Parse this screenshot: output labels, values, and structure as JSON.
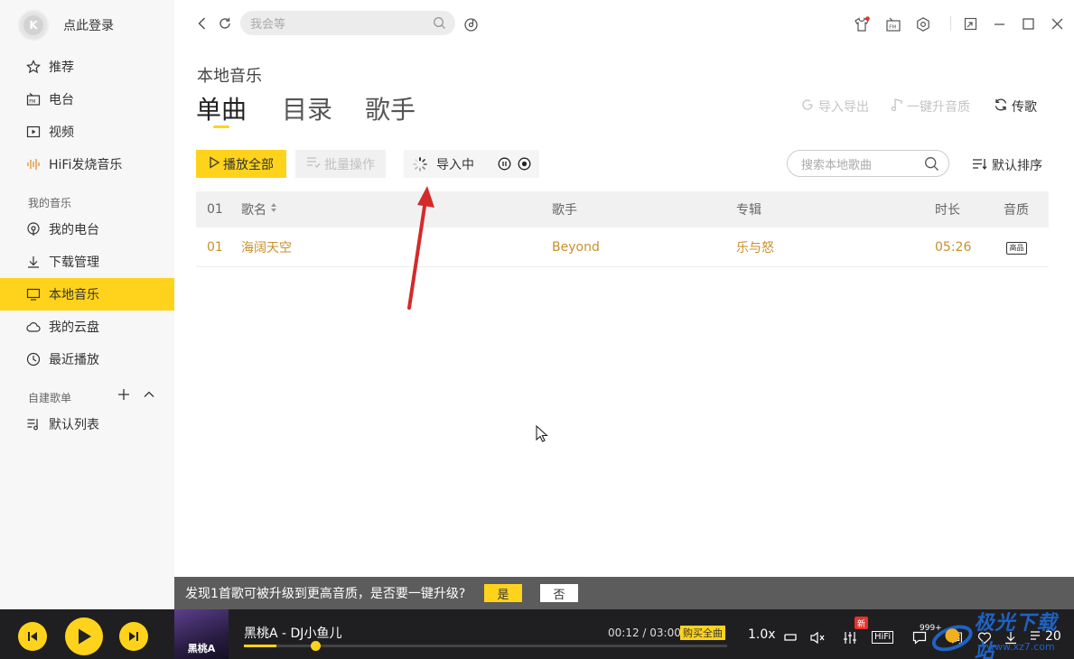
{
  "sidebar": {
    "login_text": "点此登录",
    "items": [
      {
        "label": "推荐",
        "icon": "star-icon"
      },
      {
        "label": "电台",
        "icon": "radio-icon"
      },
      {
        "label": "视频",
        "icon": "video-icon"
      },
      {
        "label": "HiFi发烧音乐",
        "icon": "waveform-icon"
      }
    ],
    "my_music_label": "我的音乐",
    "my_items": [
      {
        "label": "我的电台",
        "icon": "podcast-icon"
      },
      {
        "label": "下载管理",
        "icon": "download-icon"
      },
      {
        "label": "本地音乐",
        "icon": "monitor-icon",
        "active": true
      },
      {
        "label": "我的云盘",
        "icon": "cloud-icon"
      },
      {
        "label": "最近播放",
        "icon": "clock-icon"
      }
    ],
    "playlist_label": "自建歌单",
    "playlists": [
      {
        "label": "默认列表",
        "icon": "playlist-icon"
      }
    ]
  },
  "topbar": {
    "search_placeholder": "我会等"
  },
  "main": {
    "page_title": "本地音乐",
    "tabs": [
      {
        "label": "单曲",
        "active": true
      },
      {
        "label": "目录"
      },
      {
        "label": "歌手"
      }
    ],
    "actions": {
      "import_export": "导入导出",
      "upgrade_quality": "一键升音质",
      "upload": "传歌"
    },
    "toolbar": {
      "play_all": "播放全部",
      "batch": "批量操作",
      "importing": "导入中",
      "search_placeholder": "搜索本地歌曲",
      "sort": "默认排序"
    },
    "table": {
      "headers": {
        "num": "01",
        "title": "歌名",
        "artist": "歌手",
        "album": "专辑",
        "duration": "时长",
        "quality": "音质"
      },
      "rows": [
        {
          "num": "01",
          "title": "海阔天空",
          "artist": "Beyond",
          "album": "乐与怒",
          "duration": "05:26",
          "quality": "高品"
        }
      ]
    }
  },
  "upgrade_bar": {
    "message": "发现1首歌可被升级到更高音质，是否要一键升级?",
    "yes": "是",
    "no": "否"
  },
  "player": {
    "cover_text": "黑桃A",
    "track": "黑桃A - DJ小鱼儿",
    "time": "00:12 / 03:00",
    "buy": "购买全曲",
    "progress": 0.067,
    "speed": "1.0x",
    "hifi": "HiFi",
    "new_badge": "新",
    "comments": "999+",
    "lyric": "词",
    "playlist_count": "20"
  },
  "watermark": {
    "text": "极光下载站",
    "url": "www.xz7.com"
  },
  "colors": {
    "accent": "#ffd31b",
    "song_text": "#c8902c",
    "player_bg": "#1f1f22"
  }
}
